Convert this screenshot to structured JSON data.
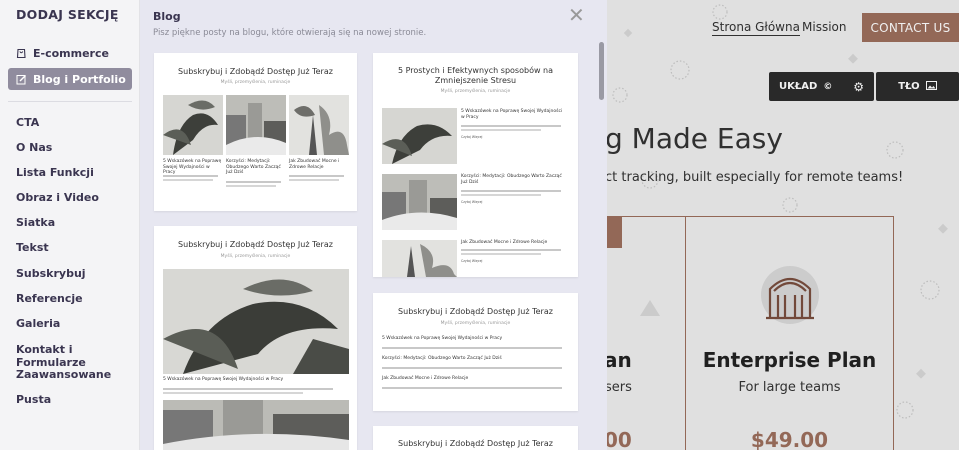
{
  "sidebar": {
    "title": "DODAJ SEKCJĘ",
    "top_items": [
      {
        "label": "E-commerce",
        "icon": "cart-icon"
      },
      {
        "label": "Blog i Portfolio",
        "icon": "edit-icon"
      }
    ],
    "categories": [
      "CTA",
      "O Nas",
      "Lista Funkcji",
      "Obraz i Video",
      "Siatka",
      "Tekst",
      "Subskrybuj",
      "Referencje",
      "Galeria",
      "Kontakt i Formularze",
      "Zaawansowane",
      "Pusta"
    ]
  },
  "panel": {
    "title": "Blog",
    "subtitle": "Pisz piękne posty na blogu, które otwierają się na nowej stronie.",
    "cards": [
      {
        "title": "Subskrybuj i Zdobądź Dostęp Już Teraz",
        "subtitle": "Myśli, przemyślenia, ruminacje",
        "posts": [
          {
            "title": "5 Wskazówek na Poprawę Swojej Wydajności w Pracy"
          },
          {
            "title": "Korzyści: Medytacji: Obudzego Warto Zacząć Już Dziś"
          },
          {
            "title": "Jak Zbudować Mocne i Zdrowe Relacje"
          }
        ]
      },
      {
        "title": "5 Prostych i Efektywnych sposobów na Zmniejszenie Stresu",
        "subtitle": "Myśli, przemyślenia, ruminacje",
        "posts": [
          {
            "title": "5 Wskazówek na Poprawę Swojej Wydajności w Pracy"
          },
          {
            "title": "Korzyści: Medytacji: Obudzego Warto Zacząć Już Dziś"
          },
          {
            "title": "Jak Zbudować Mocne i Zdrowe Relacje"
          }
        ],
        "more": "Czytaj Więcej"
      },
      {
        "title": "Subskrybuj i Zdobądź Dostęp Już Teraz",
        "subtitle": "Myśli, przemyślenia, ruminacje",
        "posts": [
          {
            "title": "5 Wskazówek na Poprawę Swojej Wydajności w Pracy"
          }
        ]
      },
      {
        "title": "Subskrybuj i Zdobądź Dostęp Już Teraz",
        "subtitle": "Myśli, przemyślenia, ruminacje",
        "posts": [
          {
            "title": "5 Wskazówek na Poprawę Swojej Wydajności w Pracy"
          },
          {
            "title": "Korzyści: Medytacji: Obudzego Warto Zacząć Już Dziś"
          },
          {
            "title": "Jak Zbudować Mocne i Zdrowe Relacje"
          }
        ]
      },
      {
        "title": "Subskrybuj i Zdobądź Dostęp Już Teraz"
      }
    ]
  },
  "site": {
    "nav": [
      "Strona Główna",
      "Mission"
    ],
    "contact": "CONTACT US",
    "controls": [
      {
        "label": "UKŁAD",
        "icon": "gear-icon"
      },
      {
        "label": "TŁO",
        "icon": "image-icon"
      }
    ],
    "hero_title": "g Made Easy",
    "hero_sub": "ct tracking, built especially for remote teams!",
    "plan_fragment": {
      "name": "an",
      "desc": "sers",
      "price": "00"
    },
    "plan": {
      "name": "Enterprise Plan",
      "desc": "For large teams",
      "price": "$49.00"
    },
    "colors": {
      "accent": "#9d6f5d",
      "dark": "#2c2c2c",
      "sidebar_text": "#3a3550",
      "selected": "#908c9e"
    }
  }
}
